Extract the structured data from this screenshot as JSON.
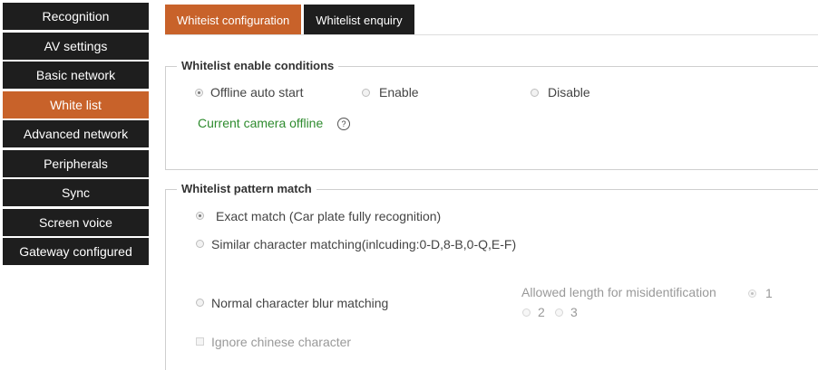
{
  "sidebar": {
    "items": [
      {
        "label": "Recognition",
        "active": false
      },
      {
        "label": "AV settings",
        "active": false
      },
      {
        "label": "Basic network",
        "active": false
      },
      {
        "label": "White list",
        "active": true
      },
      {
        "label": "Advanced network",
        "active": false
      },
      {
        "label": "Peripherals",
        "active": false
      },
      {
        "label": "Sync",
        "active": false
      },
      {
        "label": "Screen voice",
        "active": false
      },
      {
        "label": "Gateway configured",
        "active": false
      }
    ]
  },
  "tabs": [
    {
      "label": "Whiteist configuration",
      "active": true
    },
    {
      "label": "Whitelist enquiry",
      "active": false
    }
  ],
  "enable_conditions": {
    "legend": "Whitelist enable conditions",
    "options": [
      {
        "label": "Offline auto start",
        "checked": true
      },
      {
        "label": "Enable",
        "checked": false
      },
      {
        "label": "Disable",
        "checked": false
      }
    ],
    "status": "Current camera offline",
    "help_glyph": "?"
  },
  "pattern_match": {
    "legend": "Whitelist pattern match",
    "exact": {
      "label": "Exact match (Car plate fully recognition)",
      "checked": true
    },
    "similar": {
      "label": "Similar character matching(inlcuding:0-D,8-B,0-Q,E-F)",
      "checked": false
    },
    "blur": {
      "label": "Normal character blur matching",
      "checked": false
    },
    "allowed_length": {
      "label": "Allowed length for misidentification",
      "options": [
        {
          "label": "1",
          "checked": true
        },
        {
          "label": "2",
          "checked": false
        },
        {
          "label": "3",
          "checked": false
        }
      ]
    },
    "ignore_chinese": {
      "label": "Ignore chinese character",
      "checked": false
    }
  }
}
